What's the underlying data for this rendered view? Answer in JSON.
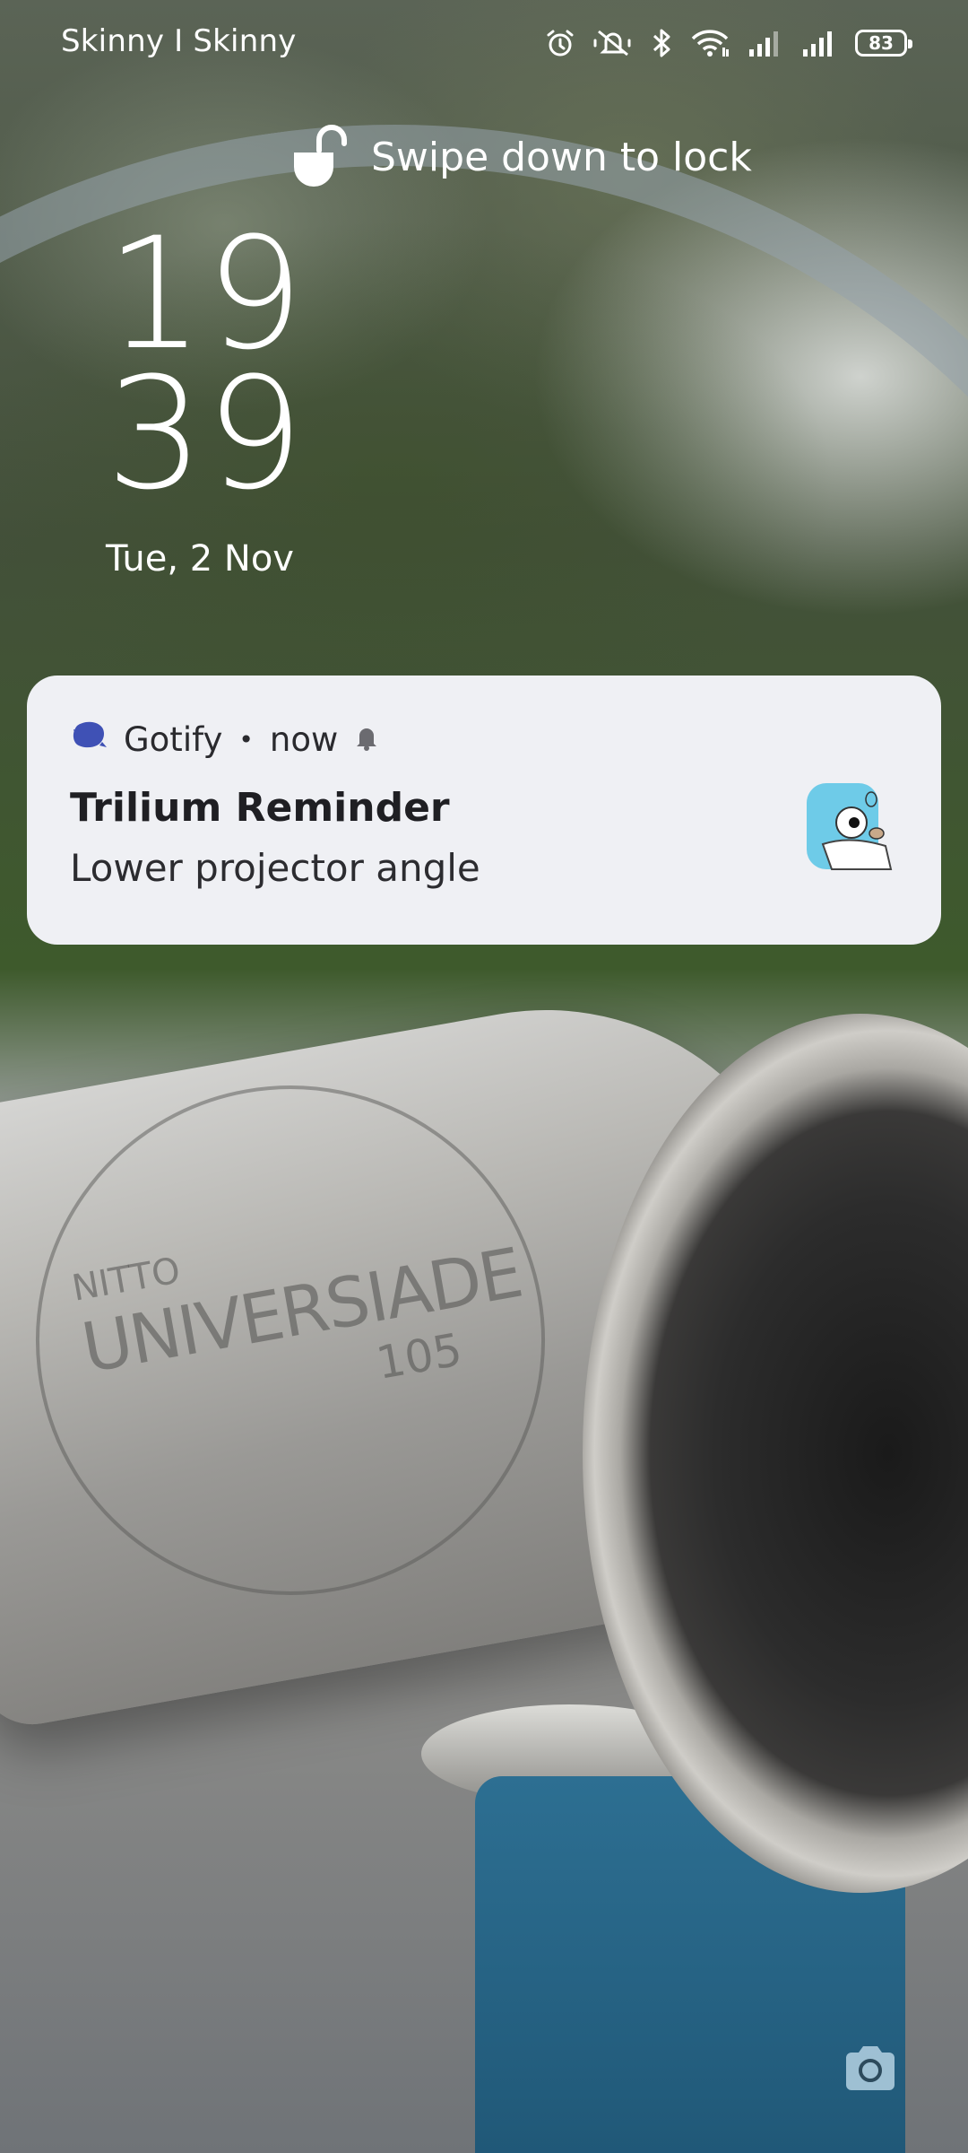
{
  "status_bar": {
    "carrier": "Skinny I Skinny",
    "battery_level": "83",
    "icons": [
      "alarm-icon",
      "mute-icon",
      "bluetooth-icon",
      "wifi-icon",
      "signal-icon",
      "signal-icon",
      "battery-icon"
    ]
  },
  "lock_hint": {
    "text": "Swipe down to lock",
    "icon": "unlock-icon"
  },
  "clock": {
    "hour": "19",
    "minute": "39",
    "date": "Tue, 2 Nov"
  },
  "notification": {
    "app_name": "Gotify",
    "separator": "•",
    "time": "now",
    "title": "Trilium Reminder",
    "body": "Lower projector angle",
    "app_icon": "gotify-icon",
    "avatar": "gopher-icon",
    "bell_icon": "bell-icon"
  },
  "wallpaper": {
    "engraving_line1": "NITTO",
    "engraving_line2": "UNIVERSIADE",
    "engraving_line3": "105"
  },
  "shortcut": {
    "icon": "camera-icon"
  },
  "colors": {
    "notification_bg": "#eff0f4",
    "gotify_brand": "#3f51b5",
    "gopher_blue": "#6ecbe8"
  }
}
